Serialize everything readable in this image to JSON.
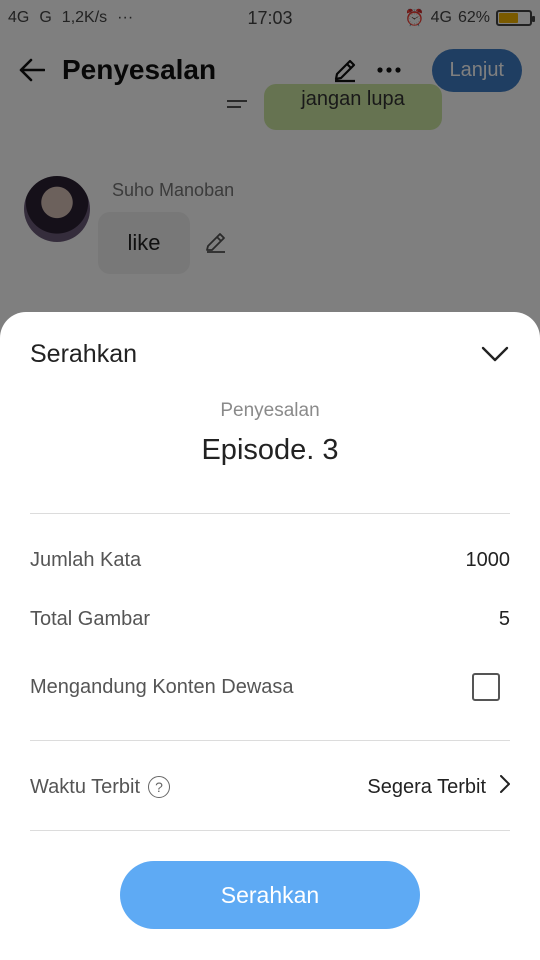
{
  "status_bar": {
    "network_1": "4G",
    "network_2": "G",
    "speed": "1,2K/s",
    "dots": "···",
    "time": "17:03",
    "net_right": "4G",
    "battery_text": "62%",
    "battery_level": 0.62,
    "battery_color": "#f5b400"
  },
  "header": {
    "title": "Penyesalan",
    "next_label": "Lanjut",
    "next_color": "#3e7cc4"
  },
  "chat": {
    "green_bubble_text": "jangan lupa",
    "sender": "Suho Manoban",
    "message": "like"
  },
  "sheet": {
    "title": "Serahkan",
    "story_name": "Penyesalan",
    "episode": "Episode. 3",
    "word_count_label": "Jumlah Kata",
    "word_count_value": "1000",
    "images_label": "Total Gambar",
    "images_value": "5",
    "adult_label": "Mengandung Konten Dewasa",
    "adult_checked": false,
    "publish_time_label": "Waktu Terbit",
    "help_glyph": "?",
    "publish_time_value": "Segera Terbit",
    "submit_label": "Serahkan",
    "submit_color": "#5eaaf4"
  }
}
